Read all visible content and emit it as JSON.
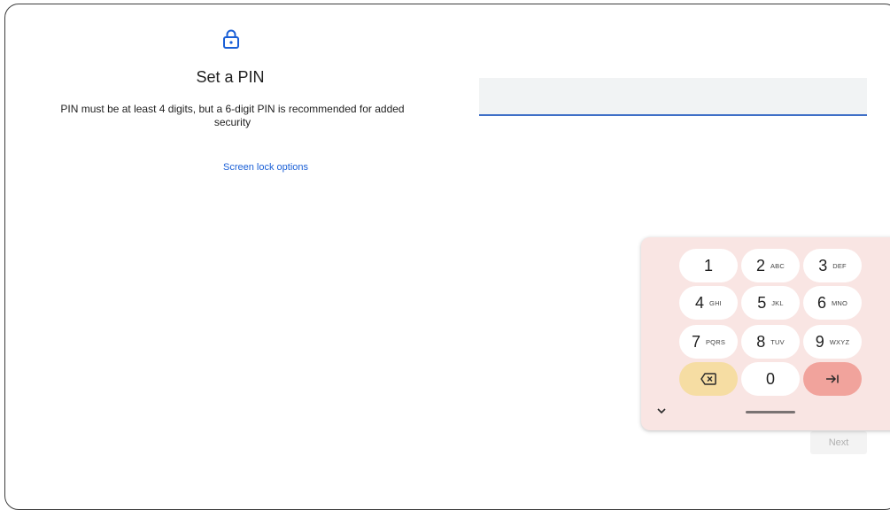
{
  "header": {
    "icon": "lock-icon",
    "title": "Set a PIN",
    "description": "PIN must be at least 4 digits, but a 6-digit PIN is recommended for added security",
    "options_link": "Screen lock options"
  },
  "pin_input": {
    "value": "",
    "placeholder": ""
  },
  "footer": {
    "next_label": "Next"
  },
  "keyboard": {
    "keys": [
      {
        "digit": "1",
        "letters": ""
      },
      {
        "digit": "2",
        "letters": "ABC"
      },
      {
        "digit": "3",
        "letters": "DEF"
      },
      {
        "digit": "4",
        "letters": "GHI"
      },
      {
        "digit": "5",
        "letters": "JKL"
      },
      {
        "digit": "6",
        "letters": "MNO"
      },
      {
        "digit": "7",
        "letters": "PQRS"
      },
      {
        "digit": "8",
        "letters": "TUV"
      },
      {
        "digit": "9",
        "letters": "WXYZ"
      },
      {
        "digit": "0",
        "letters": ""
      }
    ],
    "delete_icon": "backspace-icon",
    "action_icon": "tab-arrow-icon",
    "collapse_icon": "chevron-down-icon"
  },
  "colors": {
    "accent": "#1a5fd6",
    "input_underline": "#3f6fc7",
    "keyboard_bg": "#f9e5e3",
    "delete_key": "#f6dda3",
    "action_key": "#f1a39c"
  }
}
